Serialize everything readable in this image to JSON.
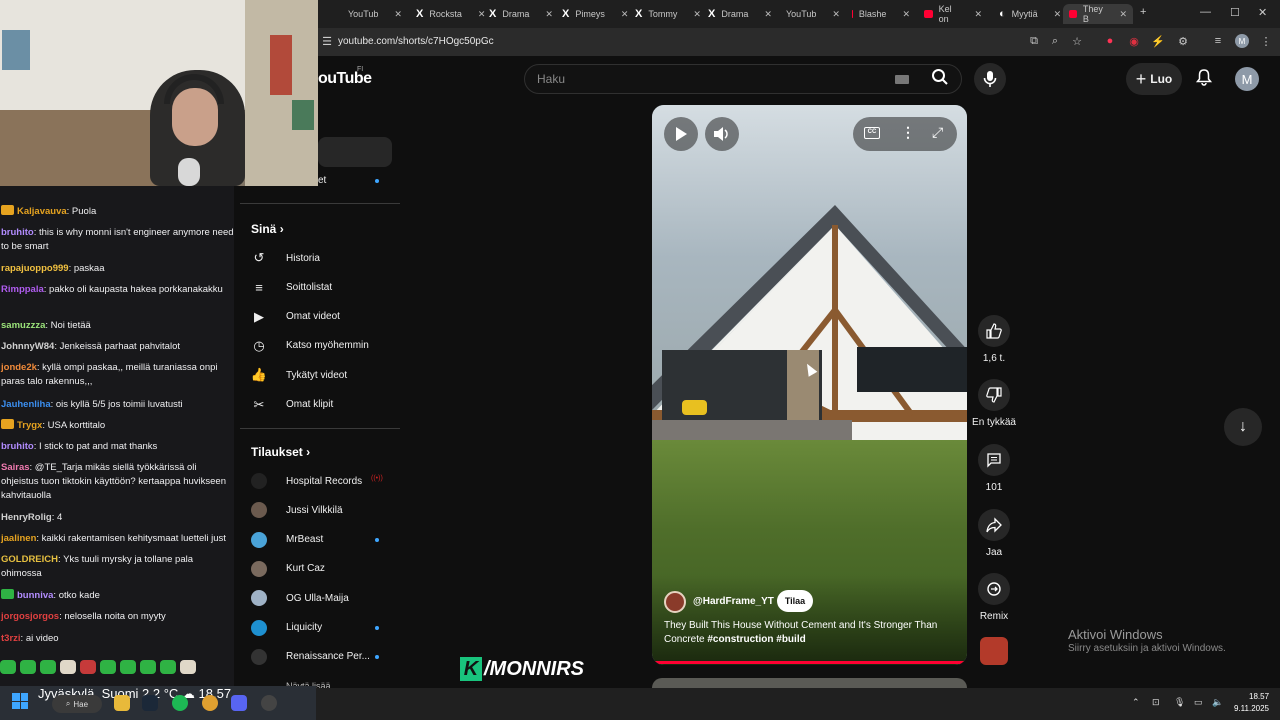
{
  "browser": {
    "tabs": [
      {
        "label": "YouTub",
        "icon": "youtube-icon"
      },
      {
        "label": "Rocksta",
        "icon": "x-icon"
      },
      {
        "label": "Drama",
        "icon": "x-icon"
      },
      {
        "label": "Pimeys",
        "icon": "x-icon"
      },
      {
        "label": "Tommy",
        "icon": "x-icon"
      },
      {
        "label": "Drama",
        "icon": "x-icon"
      },
      {
        "label": "YouTub",
        "icon": "youtube-icon"
      },
      {
        "label": "Blashe",
        "icon": "youtube-icon"
      },
      {
        "label": "Kel on",
        "icon": "youtube-icon"
      },
      {
        "label": "Myytiä",
        "icon": "generic-icon"
      },
      {
        "label": "They B",
        "icon": "youtube-icon",
        "active": true
      }
    ],
    "url": "youtube.com/shorts/c7HOgc50pGc"
  },
  "yt_header": {
    "logo": "ouTube",
    "region": "FI",
    "search_placeholder": "Haku",
    "create_label": "Luo",
    "avatar_letter": "M"
  },
  "sidebar": {
    "partial_item": "et",
    "you_heading": "Sinä",
    "you_items": [
      {
        "label": "Historia",
        "icon": "history-icon"
      },
      {
        "label": "Soittolistat",
        "icon": "playlist-icon"
      },
      {
        "label": "Omat videot",
        "icon": "your-videos-icon"
      },
      {
        "label": "Katso myöhemmin",
        "icon": "watch-later-icon"
      },
      {
        "label": "Tykätyt videot",
        "icon": "like-icon"
      },
      {
        "label": "Omat klipit",
        "icon": "scissors-icon"
      }
    ],
    "subs_heading": "Tilaukset",
    "subscriptions": [
      {
        "label": "Hospital Records",
        "color": "#222222",
        "status": "live"
      },
      {
        "label": "Jussi Vilkkilä",
        "color": "#6b5a4e",
        "status": ""
      },
      {
        "label": "MrBeast",
        "color": "#4aa3d8",
        "status": "new"
      },
      {
        "label": "Kurt Caz",
        "color": "#7a6a5e",
        "status": ""
      },
      {
        "label": "OG Ulla-Maija",
        "color": "#9fb2c6",
        "status": ""
      },
      {
        "label": "Liquicity",
        "color": "#1e90d0",
        "status": "new"
      },
      {
        "label": "Renaissance Per...",
        "color": "#333333",
        "status": "new"
      }
    ],
    "show_more": "Näytä lisää"
  },
  "short": {
    "channel": "@HardFrame_YT",
    "subscribe_label": "Tilaa",
    "title_plain": "They Built This House Without Cement and It's Stronger Than Concrete ",
    "title_tags": "#construction #build",
    "likes": "1,6 t.",
    "dislike_label": "En tykkää",
    "comments": "101",
    "share_label": "Jaa",
    "remix_label": "Remix"
  },
  "activation": {
    "title": "Aktivoi Windows",
    "subtitle": "Siirry asetuksiin ja aktivoi Windows."
  },
  "chat": [
    {
      "user": "Kaljavauva",
      "color": "#e6a320",
      "badge": "gold",
      "text": ": Puola"
    },
    {
      "user": "bruhito",
      "color": "#b28cff",
      "badge": "",
      "text": ": this is why monni isn't engineer anymore need to be smart"
    },
    {
      "user": "rapajuoppo999",
      "color": "#f0c040",
      "badge": "",
      "text": ": paskaa"
    },
    {
      "user": "Rimppala",
      "color": "#b05cf0",
      "badge": "",
      "text": ": pakko oli kaupasta hakea porkkanakakku"
    },
    {
      "user": "samuzzza",
      "color": "#9be37a",
      "badge": "",
      "text": ": Noi tietää"
    },
    {
      "user": "JohnnyW84",
      "color": "#d0d0d0",
      "badge": "",
      "text": ": Jenkeissä parhaat pahvitalot"
    },
    {
      "user": "jonde2k",
      "color": "#f08a3a",
      "badge": "",
      "text": ": kyllä ompi paskaa,, meillä turaniassa onpi paras talo rakennus,,,"
    },
    {
      "user": "Jauhenliha",
      "color": "#3b8ff0",
      "badge": "",
      "text": ": ois kyllä 5/5 jos toimii luvatusti"
    },
    {
      "user": "Trygx",
      "color": "#e6a320",
      "badge": "gold",
      "text": ": USA korttitalo"
    },
    {
      "user": "bruhito",
      "color": "#b28cff",
      "badge": "",
      "text": ": I stick to pat and mat thanks"
    },
    {
      "user": "Sairas",
      "color": "#f07ab0",
      "badge": "",
      "text": ": @TE_Tarja mikäs siellä työkkärissä oli ohjeistus tuon tiktokin käyttöön? kertaappa huvikseen kahvitauolla"
    },
    {
      "user": "HenryRolig",
      "color": "#d0d0d0",
      "badge": "",
      "text": ": 4"
    },
    {
      "user": "jaalinen",
      "color": "#e6a320",
      "badge": "",
      "text": ": kaikki rakentamisen kehitysmaat luetteli just"
    },
    {
      "user": "GOLDREICH",
      "color": "#e6c040",
      "badge": "",
      "text": ": Yks tuuli myrsky ja tollane pala ohimossa"
    },
    {
      "user": "bunniva",
      "color": "#b28cff",
      "badge": "green",
      "text": ": otko kade"
    },
    {
      "user": "jorgosjorgos",
      "color": "#e04040",
      "badge": "",
      "text": ": nelosella noita on myyty"
    },
    {
      "user": "t3rzi",
      "color": "#e04040",
      "badge": "",
      "text": ": ai video"
    }
  ],
  "overlay_logo": "/MONNIRS",
  "taskbar": {
    "weather": "Jyväskylä, Suomi   2,2 °C  ☁  18.57",
    "search_label": "Hae",
    "time": "18.57",
    "date": "9.11.2025"
  }
}
